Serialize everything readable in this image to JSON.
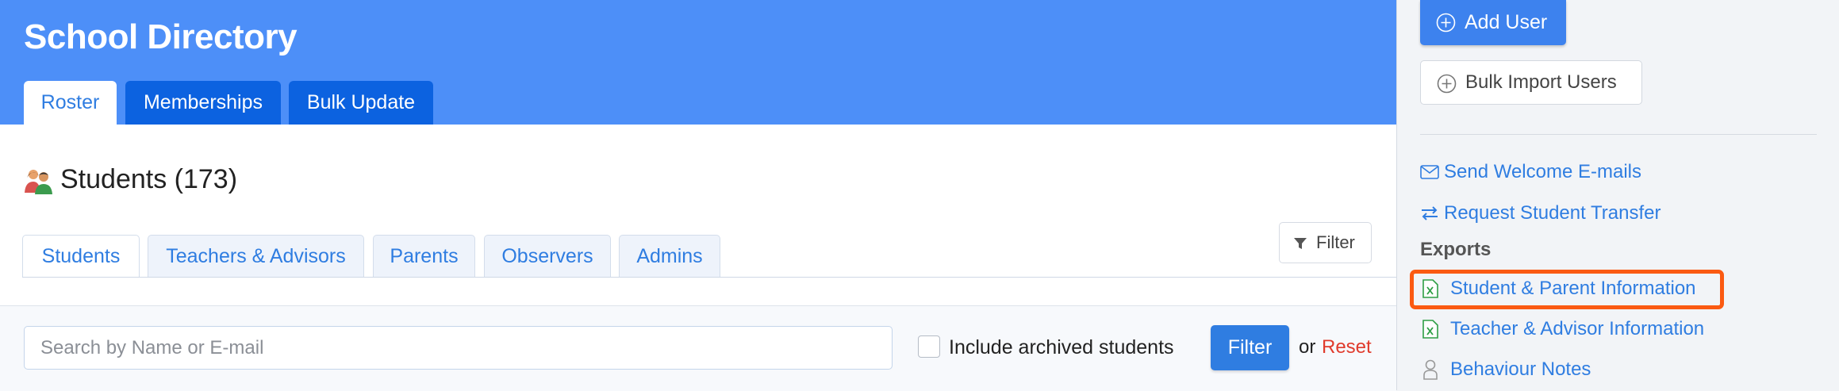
{
  "header": {
    "title": "School Directory",
    "tabs": [
      {
        "label": "Roster"
      },
      {
        "label": "Memberships"
      },
      {
        "label": "Bulk Update"
      }
    ]
  },
  "section": {
    "icon": "people-icon",
    "title": "Students (173)"
  },
  "sub_tabs": [
    {
      "label": "Students"
    },
    {
      "label": "Teachers & Advisors"
    },
    {
      "label": "Parents"
    },
    {
      "label": "Observers"
    },
    {
      "label": "Admins"
    }
  ],
  "filter_toggle": {
    "label": "Filter",
    "icon": "funnel-icon"
  },
  "filter_bar": {
    "search_placeholder": "Search by Name or E-mail",
    "search_value": "",
    "include_archived_label": "Include archived students",
    "include_archived_checked": false,
    "submit_label": "Filter",
    "or_text": "or",
    "reset_label": "Reset"
  },
  "sidebar": {
    "add_user_label": "Add User",
    "bulk_import_label": "Bulk Import Users",
    "send_welcome_label": "Send Welcome E-mails",
    "request_transfer_label": "Request Student Transfer",
    "exports_heading": "Exports",
    "exports": [
      {
        "label": "Student & Parent Information",
        "icon": "excel-file-icon"
      },
      {
        "label": "Teacher & Advisor Information",
        "icon": "excel-file-icon"
      },
      {
        "label": "Behaviour Notes",
        "icon": "person-icon"
      }
    ]
  },
  "colors": {
    "header_bg": "#4d8ff8",
    "dark_tab": "#0c62e0",
    "link": "#2f7de1",
    "reset": "#e03b2c",
    "highlight": "#fb5a12"
  }
}
